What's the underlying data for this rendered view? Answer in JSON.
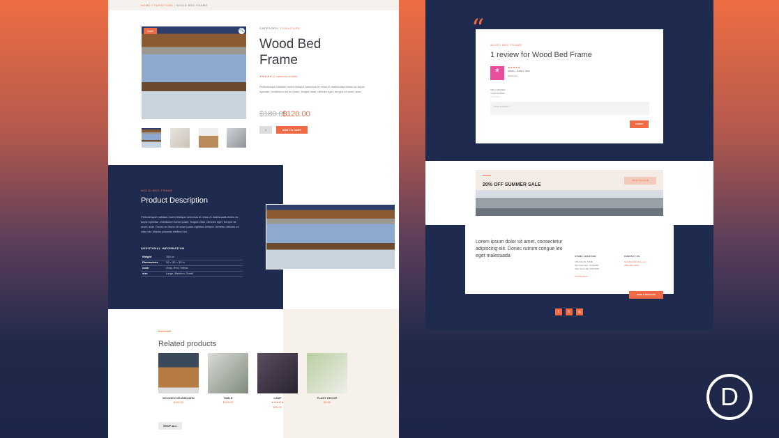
{
  "breadcrumb": {
    "home": "HOME",
    "sep": " / ",
    "category": "FURNITURE",
    "current": "WOOD BED FRAME"
  },
  "product": {
    "sale_badge": "Sale!",
    "category_label": "CATEGORY:",
    "category": "FURNITURE",
    "title": "Wood Bed Frame",
    "rating_stars": "★★★★★",
    "review_link": "(1 customer review)",
    "description": "Pellentesque habitant morbi tristique senectus et netus et malesuada fames ac turpis egestas. Vestibulum tortor quam, feugiat vitae, ultricies eget, tempor sit amet, ante.",
    "old_price": "$180.00",
    "new_price": "$120.00",
    "quantity": "1",
    "add_to_cart": "ADD TO CART"
  },
  "description_section": {
    "tag": "WOOD BED FRAME",
    "title": "Product Description",
    "text": "Pellentesque habitant morbi tristique senectus et netus et malesuada fames ac turpis egestas. Vestibulum tortor quam, feugiat vitae, ultricies eget, tempor sit amet, ante. Donec eu libero sit amet quam egestas semper. Aenean ultricies mi vitae est. Mauris placerat eleifend leo.",
    "additional_heading": "ADDITIONAL INFORMATION",
    "attributes": [
      {
        "key": "Weight",
        "value": "150 oz"
      },
      {
        "key": "Dimensions",
        "value": "30 × 30 × 30 in"
      },
      {
        "key": "color",
        "value": "Gray, Red, Yellow"
      },
      {
        "key": "size",
        "value": "Large, Medium, Small"
      }
    ]
  },
  "related": {
    "title": "Related products",
    "products": [
      {
        "name": "WOODEN HEADBOARD",
        "price": "$150.00",
        "stars": ""
      },
      {
        "name": "TABLE",
        "price": "$155.00",
        "stars": ""
      },
      {
        "name": "LAMP",
        "price": "$35.00",
        "stars": "★★★★★"
      },
      {
        "name": "PLANT DECOR",
        "price": "$9.50",
        "stars": ""
      }
    ],
    "shop_all": "SHOP ALL"
  },
  "review": {
    "quote": "“",
    "tag": "WOOD BED FRAME",
    "title": "1 review for Wood Bed Frame",
    "avatar": "*",
    "stars": "★★★★★",
    "meta": "ADMIN – JUNE 4, 2020",
    "body": "Awesome!",
    "add_review": "ADD A REVIEW",
    "your_rating": "YOUR RATING",
    "empty_stars": "☆☆☆☆☆",
    "input_placeholder": "Your review *",
    "submit": "SUBMIT"
  },
  "sale": {
    "title": "20% OFF SUMMER SALE",
    "button": "SHOP THE SALE"
  },
  "contact": {
    "lorem": "Lorem ipsum dolor sit amet, consectetur adipiscing elit. Donec rutrum congue leo eget malesuada",
    "store_heading": "STORE LOCATION",
    "address_1": "1234 Divi St. #1000",
    "address_2": "San Francisco, CA 94158",
    "address_3": "Open Everyday 9AM-5PM",
    "directions": "Get Directions",
    "contact_heading": "CONTACT US",
    "email": "hello@divifurniture.com",
    "phone": "(255) 352-6258",
    "send": "SEND A MESSAGE"
  },
  "social": {
    "facebook": "f",
    "twitter": "t",
    "instagram": "◎"
  },
  "logo": "D",
  "colors": {
    "accent": "#ef6b45",
    "navy": "#1f2a4f",
    "beige": "#f6f1eb"
  }
}
